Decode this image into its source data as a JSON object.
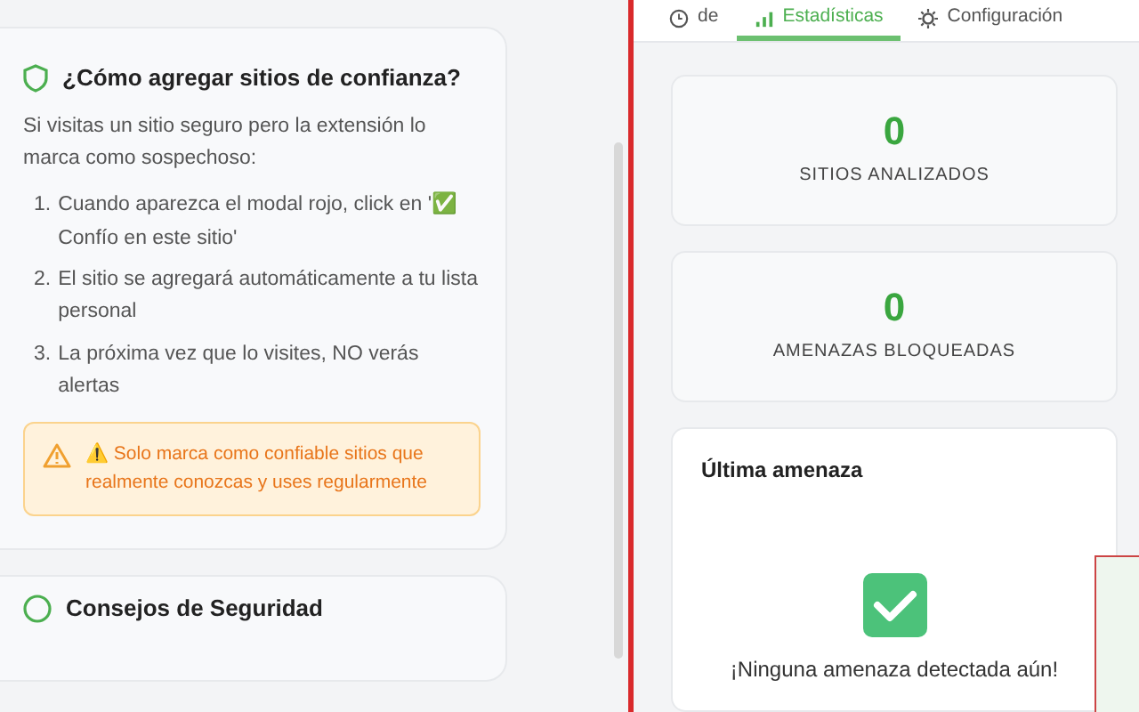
{
  "guide": {
    "title": "¿Cómo agregar sitios de confianza?",
    "intro": "Si visitas un sitio seguro pero la extensión lo marca como sospechoso:",
    "steps": [
      {
        "number": "1.",
        "text": "Cuando aparezca el modal rojo, click en '✅ Confío en este sitio'"
      },
      {
        "number": "2.",
        "text": "El sitio se agregará automáticamente a tu lista personal"
      },
      {
        "number": "3.",
        "text": "La próxima vez que lo visites, NO verás alertas"
      }
    ],
    "warning": "⚠️ Solo marca como confiable sitios que realmente conozcas y uses regularmente"
  },
  "next_card": {
    "title": "Consejos de Seguridad"
  },
  "tabs": [
    {
      "label": "de",
      "selected": false
    },
    {
      "label": "Estadísticas",
      "selected": true
    },
    {
      "label": "Configuración",
      "selected": false
    }
  ],
  "stats": [
    {
      "value": "0",
      "label": "SITIOS ANALIZADOS"
    },
    {
      "value": "0",
      "label": "AMENAZAS BLOQUEADAS"
    }
  ],
  "last_threat": {
    "title": "Última amenaza",
    "message": "¡Ninguna amenaza detectada aún!"
  }
}
